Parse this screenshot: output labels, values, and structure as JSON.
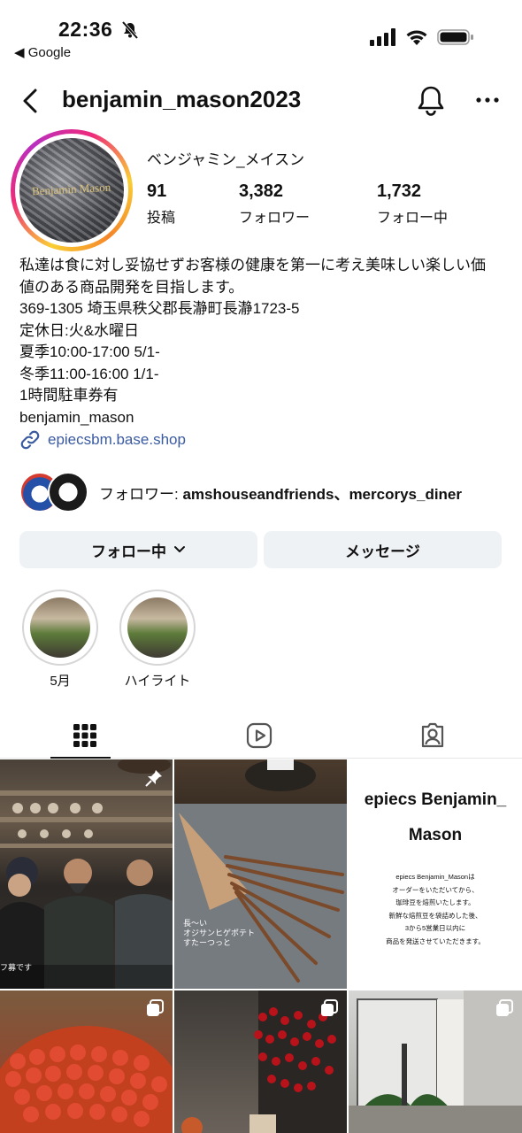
{
  "status_bar": {
    "time": "22:36",
    "back_app": "◀ Google"
  },
  "header": {
    "username": "benjamin_mason2023"
  },
  "profile": {
    "display_name": "ベンジャミン_メイスン",
    "avatar_text": "Benjamin Mason",
    "stats": [
      {
        "value": "91",
        "label": "投稿"
      },
      {
        "value": "3,382",
        "label": "フォロワー"
      },
      {
        "value": "1,732",
        "label": "フォロー中"
      }
    ],
    "bio_lines": [
      "私達は食に対し妥協せずお客様の健康を第一に考え美味しい楽しい価",
      "値のある商品開発を目指します。",
      "369-1305 埼玉県秩父郡長瀞町長瀞1723-5",
      "定休日:火&水曜日",
      "夏季10:00-17:00 5/1-",
      "冬季11:00-16:00 1/1-",
      "1時間駐車券有",
      "benjamin_mason"
    ],
    "link": "epiecsbm.base.shop",
    "followed_prefix": "フォロワー: ",
    "followed_names": "amshouseandfriends、mercorys_diner"
  },
  "buttons": {
    "following": "フォロー中",
    "message": "メッセージ"
  },
  "highlights": [
    {
      "label": "5月"
    },
    {
      "label": "ハイライト"
    }
  ],
  "posts": {
    "p2_caption": "長〜い\nオジサンヒゲポテト\nすたーつっと",
    "p3_title": "epiecs Benjamin_\nMason",
    "p3_body": "epiecs Benjamin_Masonは\nオーダーをいただいてから、\n珈琲豆を焙煎いたします。\n新鮮な焙煎豆を袋詰めした後、\n3から5営業日以内に\n商品を発送させていただきます。",
    "p1_caption": "フ募です"
  },
  "colors": {
    "link": "#3a5ba0",
    "button_bg": "#eff2f5"
  }
}
